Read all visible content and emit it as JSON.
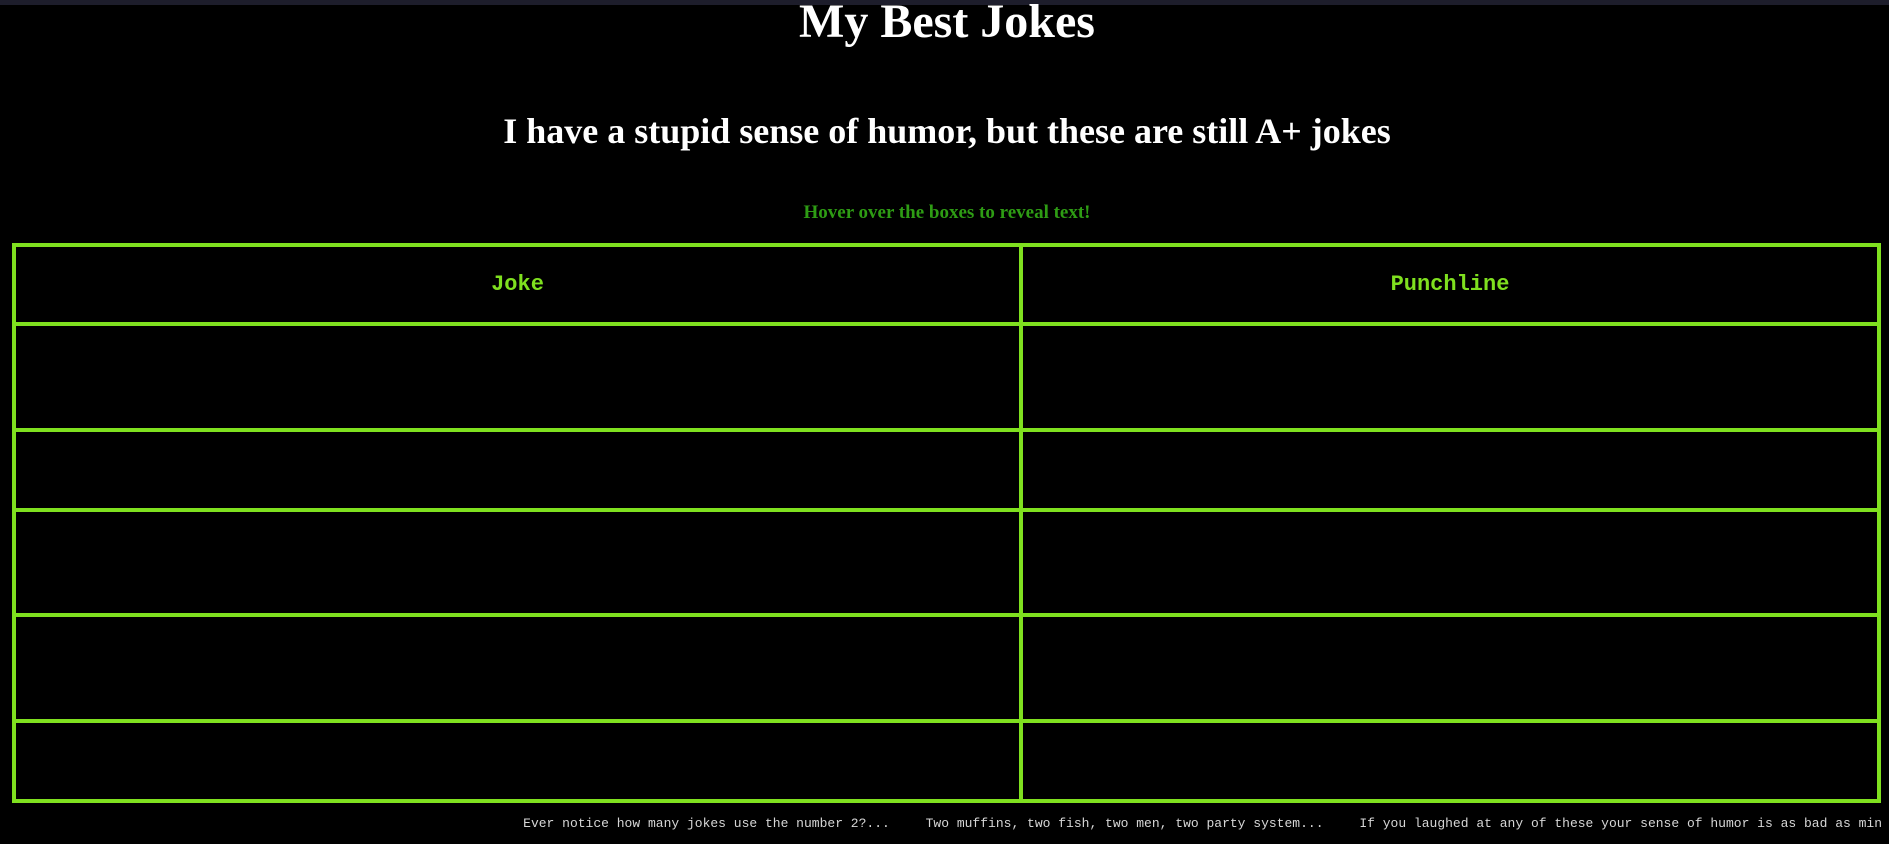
{
  "header": {
    "title": "My Best Jokes",
    "subtitle": "I have a stupid sense of humor, but these are still A+ jokes",
    "hint": "Hover over the boxes to reveal text!"
  },
  "table": {
    "columns": [
      "Joke",
      "Punchline"
    ],
    "rows": [
      {
        "joke": "",
        "punchline": ""
      },
      {
        "joke": "",
        "punchline": ""
      },
      {
        "joke": "",
        "punchline": ""
      },
      {
        "joke": "",
        "punchline": ""
      },
      {
        "joke": "",
        "punchline": ""
      }
    ]
  },
  "footer": {
    "notes": [
      "Ever notice how many jokes use the number 2?...",
      "Two muffins, two fish, two men, two party system...",
      "If you laughed at any of these your sense of humor is as bad as min"
    ]
  },
  "colors": {
    "background": "#000000",
    "accent_green": "#7fe01f",
    "hint_green": "#2e9c14",
    "text": "#ffffff"
  }
}
